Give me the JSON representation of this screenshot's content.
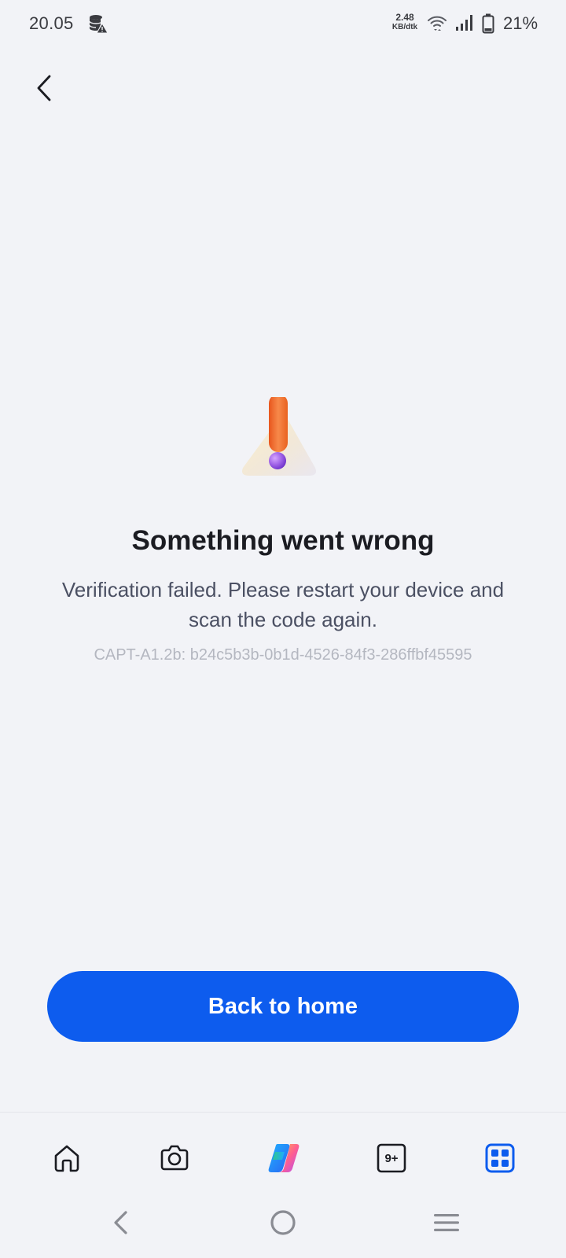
{
  "status_bar": {
    "time": "20.05",
    "net_speed_value": "2.48",
    "net_speed_unit": "KB/dtk",
    "battery_percent": "21%",
    "icons": [
      "database-warning-icon",
      "wifi-icon",
      "signal-icon",
      "battery-icon"
    ]
  },
  "header": {
    "back_icon": "chevron-left-icon"
  },
  "error": {
    "illustration": "warning-triangle-icon",
    "title": "Something went wrong",
    "message": "Verification failed. Please restart your device and scan the code again.",
    "code": "CAPT-A1.2b: b24c5b3b-0b1d-4526-84f3-286ffbf45595"
  },
  "actions": {
    "home_button_label": "Back to home"
  },
  "tab_bar": {
    "items": [
      {
        "icon": "home-icon"
      },
      {
        "icon": "camera-icon"
      },
      {
        "icon": "copilot-icon"
      },
      {
        "icon": "tabs-icon",
        "badge": "9+"
      },
      {
        "icon": "apps-grid-icon",
        "active": true
      }
    ]
  },
  "system_nav": {
    "icons": [
      "back-icon",
      "home-circle-icon",
      "menu-icon"
    ]
  },
  "colors": {
    "background": "#f2f3f7",
    "accent": "#0d5cee",
    "title_text": "#1b1c22",
    "body_text": "#4b5063",
    "muted_text": "#b4b7c0",
    "warning_orange": "#f07a35",
    "warning_purple": "#9b5de5"
  }
}
